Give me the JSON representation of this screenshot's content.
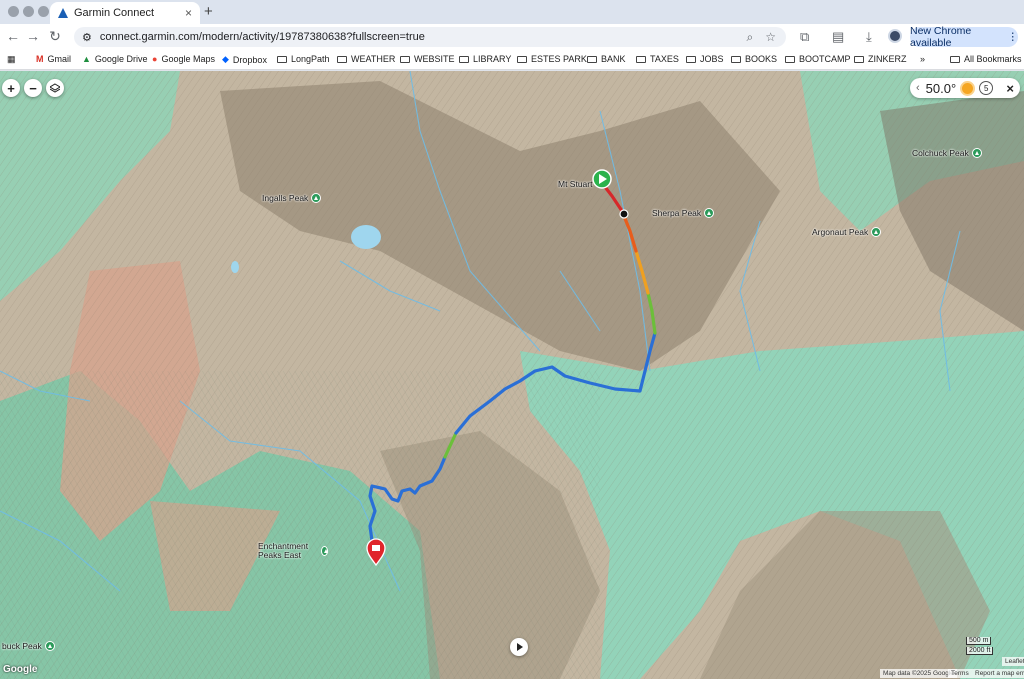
{
  "window": {
    "tab_title": "Garmin Connect"
  },
  "toolbar": {
    "url": "connect.garmin.com/modern/activity/19787380638?fullscreen=true",
    "update_label": "New Chrome available"
  },
  "bookmarks": [
    {
      "label": "Gmail"
    },
    {
      "label": "Google Drive"
    },
    {
      "label": "Google Maps"
    },
    {
      "label": "Dropbox"
    },
    {
      "label": "LongPath"
    },
    {
      "label": "WEATHER"
    },
    {
      "label": "WEBSITE"
    },
    {
      "label": "LIBRARY"
    },
    {
      "label": "ESTES PARK"
    },
    {
      "label": "BANK"
    },
    {
      "label": "TAXES"
    },
    {
      "label": "JOBS"
    },
    {
      "label": "BOOKS"
    },
    {
      "label": "BOOTCAMP"
    },
    {
      "label": "ZINKERZ"
    },
    {
      "label": "All Bookmarks"
    }
  ],
  "map": {
    "controls": {
      "zoom_in": "+",
      "zoom_out": "−"
    },
    "weather": {
      "temperature": "50.0°",
      "wind": "5"
    },
    "peaks": [
      {
        "label": "Ingalls Peak"
      },
      {
        "label": "Mt Stuart"
      },
      {
        "label": "Sherpa Peak"
      },
      {
        "label": "Argonaut Peak"
      },
      {
        "label": "Colchuck Peak"
      },
      {
        "label": "Enchantment Peaks East"
      },
      {
        "label": "buck Peak"
      }
    ],
    "scale": {
      "metric": "500 m",
      "imperial": "2000 ft"
    },
    "attribution": {
      "map_data": "Map data ©2025 Google",
      "terms": "Terms",
      "report": "Report a map error",
      "leaflet": "Leaflet"
    },
    "google_logo": "Google"
  },
  "colors": {
    "route_low": "#2a6fd6",
    "route_mid": "#6cbf3a",
    "route_high": "#e53e1f",
    "start": "#2bb24c",
    "end": "#e0252b"
  }
}
